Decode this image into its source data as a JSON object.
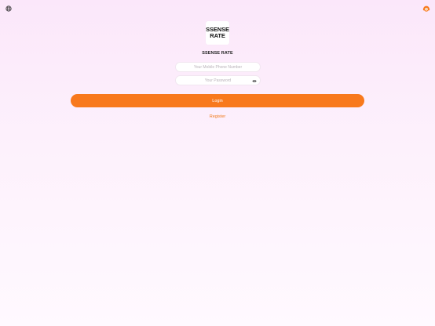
{
  "header": {
    "language_icon": "globe-icon",
    "support_icon": "customer-service-icon"
  },
  "logo": {
    "line1": "SSENSE",
    "line2": "RATE"
  },
  "app_name": "SSENSE RATE",
  "form": {
    "phone_placeholder": "Your Mobile Phone Number",
    "phone_value": "",
    "password_placeholder": "Your Password",
    "password_value": "",
    "password_toggle_icon": "eye-icon"
  },
  "login_label": "Login",
  "register_label": "Register",
  "colors": {
    "accent": "#f8791c",
    "link": "#f07a1a",
    "background_top": "#fbe7fa",
    "background_bottom": "#fff9ff"
  }
}
